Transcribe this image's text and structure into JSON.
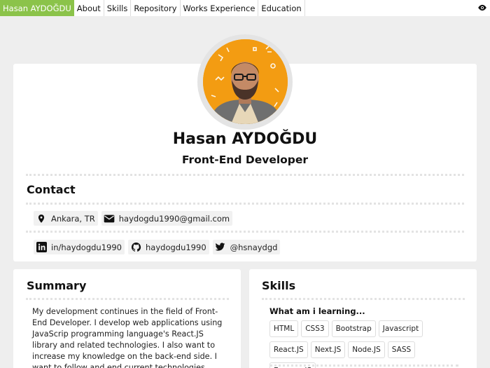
{
  "nav": {
    "brand": "Hasan AYDOĞDU",
    "items": [
      "About",
      "Skills",
      "Repository",
      "Works Experience",
      "Education"
    ]
  },
  "profile": {
    "name": "Hasan AYDOĞDU",
    "role": "Front-End Developer"
  },
  "contact": {
    "title": "Contact",
    "location": "Ankara, TR",
    "email": "haydogdu1990@gmail.com",
    "linkedin": "in/haydogdu1990",
    "github": "haydogdu1990",
    "twitter": "@hsnaydgd"
  },
  "summary": {
    "title": "Summary",
    "text": "My development continues in the field of Front-End Developer. I develop web applications using JavaScrip programming language's React.JS library and related technologies. I also want to increase my knowledge on the back-end side. I want to follow and end current technologies."
  },
  "skills": {
    "title": "Skills",
    "learning_label": "What am i learning...",
    "tags": [
      "HTML",
      "CSS3",
      "Bootstrap",
      "Javascript",
      "React.JS",
      "Next.JS",
      "Node.JS",
      "SASS",
      "Express.JS"
    ]
  },
  "colors": {
    "accent": "#8bc34a",
    "avatar_bg": "#f39c12",
    "twitter": "#1da1f2"
  }
}
